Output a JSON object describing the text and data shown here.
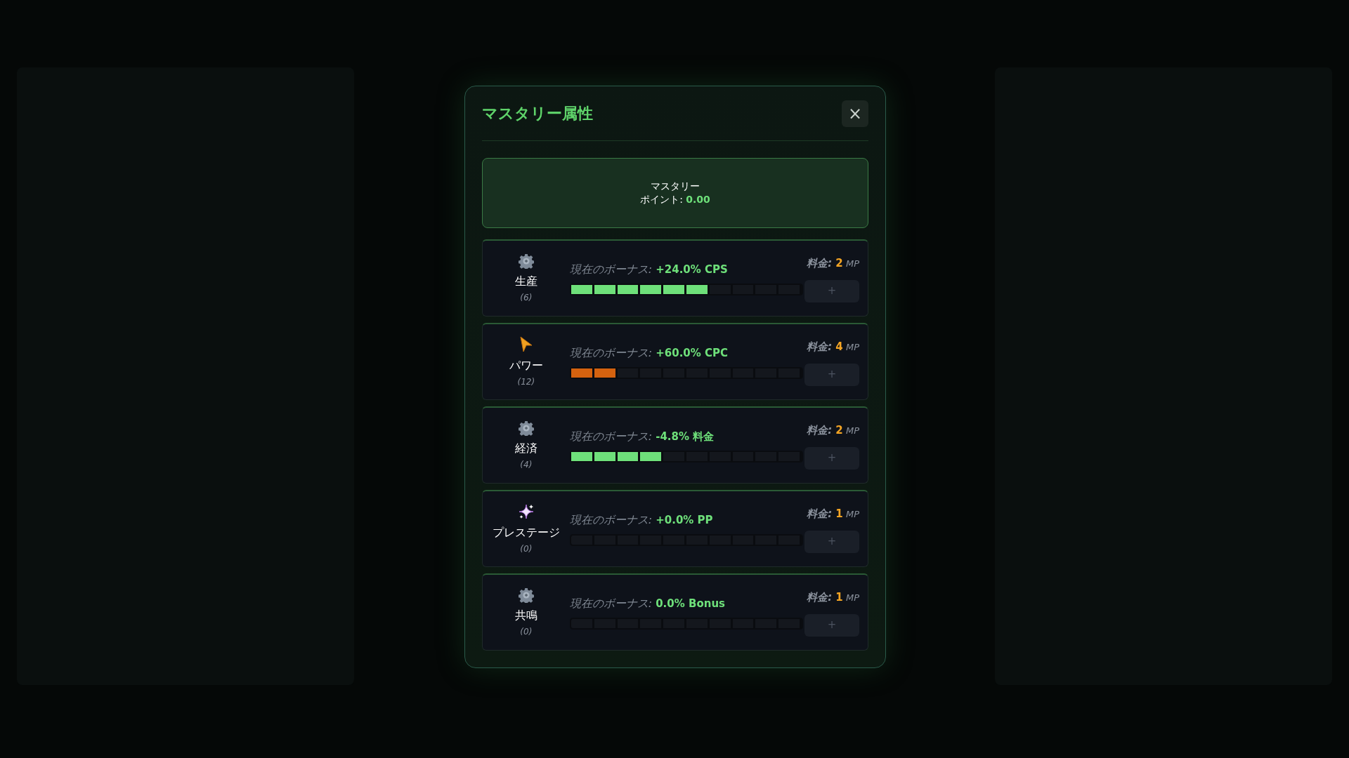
{
  "dialog": {
    "title": "マスタリー属性",
    "close": "×"
  },
  "points": {
    "line1": "マスタリー",
    "label": "ポイント:",
    "value": "0.00"
  },
  "attributes": [
    {
      "kind": "gear",
      "name": "生産",
      "count": "(6)",
      "bonus_label": "現在のボーナス:",
      "bonus_value": "+24.0% CPS",
      "level": 0.6,
      "color": "#6ee07a",
      "cost_label": "料金:",
      "cost_value": "2",
      "cost_unit": "MP",
      "button": "+",
      "disabled": true
    },
    {
      "kind": "cursor",
      "name": "パワー",
      "count": "(12)",
      "bonus_label": "現在のボーナス:",
      "bonus_value": "+60.0% CPC",
      "level": 0.2,
      "color": "#d4620f",
      "cost_label": "料金:",
      "cost_value": "4",
      "cost_unit": "MP",
      "button": "+",
      "disabled": true
    },
    {
      "kind": "gear",
      "name": "経済",
      "count": "(4)",
      "bonus_label": "現在のボーナス:",
      "bonus_value": "-4.8% 料金",
      "level": 0.4,
      "color": "#6ee07a",
      "cost_label": "料金:",
      "cost_value": "2",
      "cost_unit": "MP",
      "button": "+",
      "disabled": true
    },
    {
      "kind": "sparkle",
      "name": "プレステージ",
      "count": "(0)",
      "bonus_label": "現在のボーナス:",
      "bonus_value": "+0.0% PP",
      "level": 0,
      "cost_label": "料金:",
      "cost_value": "1",
      "cost_unit": "MP",
      "button": "+",
      "disabled": true
    },
    {
      "kind": "gear",
      "name": "共鳴",
      "count": "(0)",
      "bonus_label": "現在のボーナス:",
      "bonus_value": "0.0% Bonus",
      "level": 0,
      "cost_label": "料金:",
      "cost_value": "1",
      "cost_unit": "MP",
      "button": "+",
      "disabled": true
    }
  ]
}
